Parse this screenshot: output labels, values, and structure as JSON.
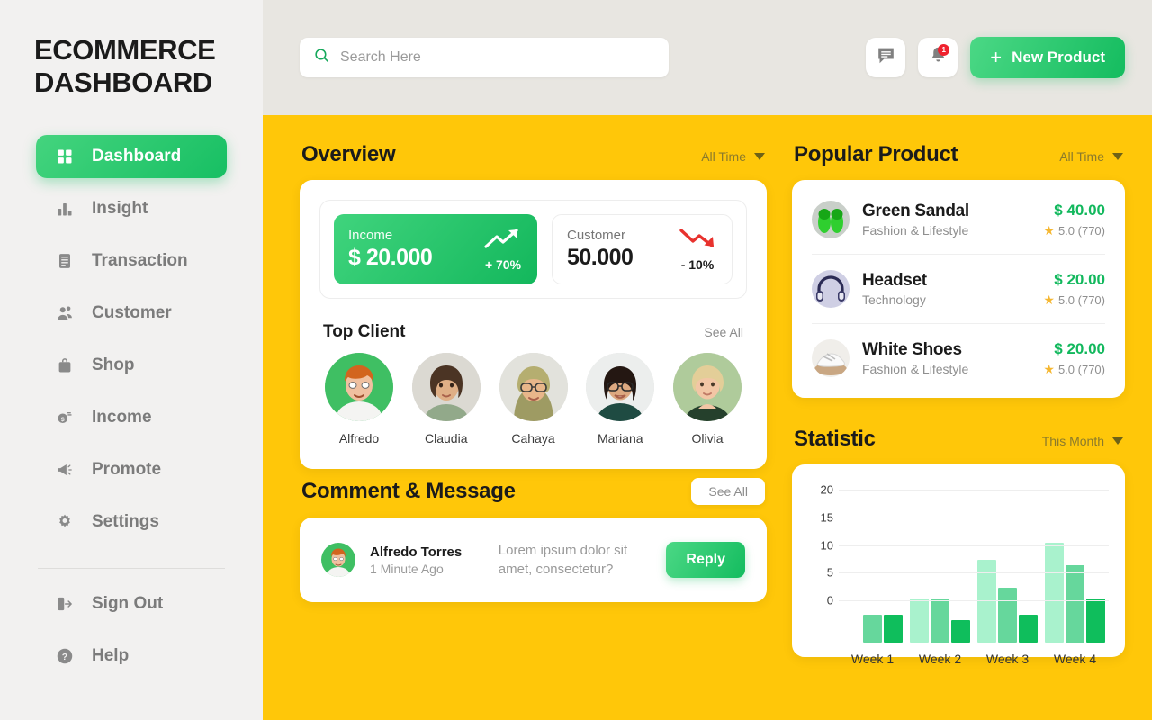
{
  "sidebar": {
    "brand_line1": "ECOMMERCE",
    "brand_line2": "DASHBOARD",
    "items": [
      {
        "label": "Dashboard",
        "icon": "grid-icon",
        "active": true
      },
      {
        "label": "Insight",
        "icon": "bar-chart-icon",
        "active": false
      },
      {
        "label": "Transaction",
        "icon": "list-icon",
        "active": false
      },
      {
        "label": "Customer",
        "icon": "users-icon",
        "active": false
      },
      {
        "label": "Shop",
        "icon": "bag-icon",
        "active": false
      },
      {
        "label": "Income",
        "icon": "money-icon",
        "active": false
      },
      {
        "label": "Promote",
        "icon": "megaphone-icon",
        "active": false
      },
      {
        "label": "Settings",
        "icon": "gear-icon",
        "active": false
      }
    ],
    "footer_items": [
      {
        "label": "Sign Out",
        "icon": "sign-out-icon"
      },
      {
        "label": "Help",
        "icon": "help-icon"
      }
    ]
  },
  "topbar": {
    "search_placeholder": "Search Here",
    "search_value": "",
    "message_icon": "message-icon",
    "notification_icon": "bell-icon",
    "notification_count": "1",
    "new_product_label": "New Product",
    "new_product_plus": "+"
  },
  "overview": {
    "title": "Overview",
    "filter": "All Time",
    "income": {
      "label": "Income",
      "value": "$ 20.000",
      "delta": "+ 70%",
      "trend": "up"
    },
    "customer": {
      "label": "Customer",
      "value": "50.000",
      "delta": "- 10%",
      "trend": "down"
    }
  },
  "top_client": {
    "title": "Top Client",
    "see_all": "See All",
    "clients": [
      {
        "name": "Alfredo"
      },
      {
        "name": "Claudia"
      },
      {
        "name": "Cahaya"
      },
      {
        "name": "Mariana"
      },
      {
        "name": "Olivia"
      }
    ]
  },
  "comments": {
    "title": "Comment & Message",
    "see_all": "See All",
    "items": [
      {
        "name": "Alfredo Torres",
        "time": "1 Minute Ago",
        "text": "Lorem ipsum dolor sit amet, consectetur?",
        "reply_label": "Reply"
      }
    ]
  },
  "popular_product": {
    "title": "Popular Product",
    "filter": "All Time",
    "items": [
      {
        "name": "Green Sandal",
        "category": "Fashion & Lifestyle",
        "price": "$ 40.00",
        "rating": "5.0 (770)"
      },
      {
        "name": "Headset",
        "category": "Technology",
        "price": "$ 20.00",
        "rating": "5.0 (770)"
      },
      {
        "name": "White Shoes",
        "category": "Fashion & Lifestyle",
        "price": "$ 20.00",
        "rating": "5.0 (770)"
      }
    ]
  },
  "statistic": {
    "title": "Statistic",
    "filter": "This Month"
  },
  "chart_data": {
    "type": "bar",
    "title": "Statistic",
    "categories": [
      "Week 1",
      "Week 2",
      "Week 3",
      "Week 4"
    ],
    "series": [
      {
        "name": "Series A",
        "color": "#A9F2CD",
        "values": [
          0,
          8,
          15,
          18
        ]
      },
      {
        "name": "Series B",
        "color": "#66D79C",
        "values": [
          5,
          8,
          10,
          14
        ]
      },
      {
        "name": "Series C",
        "color": "#0FBE5C",
        "values": [
          5,
          4,
          5,
          8
        ]
      }
    ],
    "ylim": [
      0,
      20
    ],
    "yticks": [
      0,
      5,
      10,
      15,
      20
    ],
    "xlabel": "",
    "ylabel": "",
    "grid": true,
    "legend": "none"
  },
  "colors": {
    "page_yellow": "#FFC709",
    "topbar_grey": "#E8E6E1",
    "sidebar_grey": "#F2F1F0",
    "accent_green": "#14BC5F",
    "danger_red": "#F0222E",
    "star_gold": "#F5B731"
  }
}
